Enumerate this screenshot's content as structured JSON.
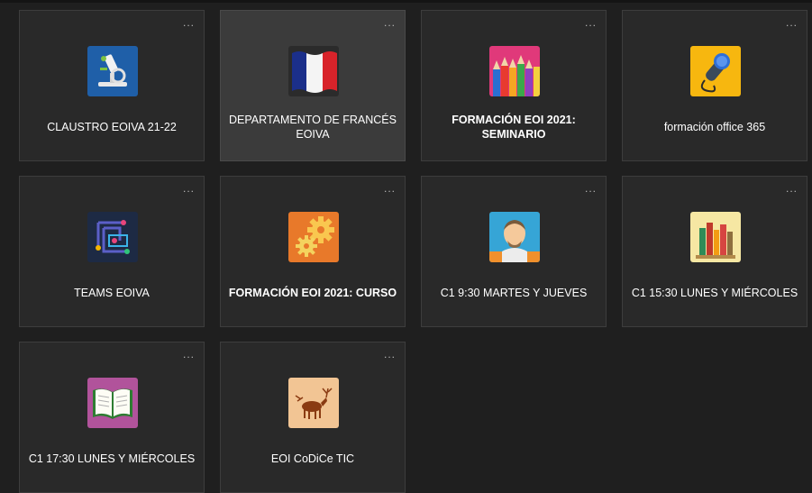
{
  "more_label": "...",
  "teams": [
    {
      "name": "CLAUSTRO EOIVA 21-22",
      "icon": "microscope-icon",
      "bold": false
    },
    {
      "name": "DEPARTAMENTO DE FRANCÉS EOIVA",
      "icon": "french-flag-icon",
      "bold": false
    },
    {
      "name": "FORMACIÓN EOI 2021: SEMINARIO",
      "icon": "colored-pencils-icon",
      "bold": true
    },
    {
      "name": "formación office 365",
      "icon": "microphone-icon",
      "bold": false
    },
    {
      "name": "TEAMS EOIVA",
      "icon": "circuit-icon",
      "bold": false
    },
    {
      "name": "FORMACIÓN EOI 2021: CURSO",
      "icon": "gears-icon",
      "bold": true
    },
    {
      "name": "C1 9:30 MARTES Y JUEVES",
      "icon": "shakespeare-icon",
      "bold": false
    },
    {
      "name": "C1 15:30 LUNES Y MIÉRCOLES",
      "icon": "books-icon",
      "bold": false
    },
    {
      "name": "C1 17:30 LUNES Y MIÉRCOLES",
      "icon": "open-book-icon",
      "bold": false
    },
    {
      "name": "EOI CoDiCe TIC",
      "icon": "cave-painting-icon",
      "bold": false
    }
  ],
  "colors": {
    "background": "#1f1f1f",
    "card": "#292929",
    "card_hover": "#3b3b3b",
    "text": "#ffffff"
  }
}
